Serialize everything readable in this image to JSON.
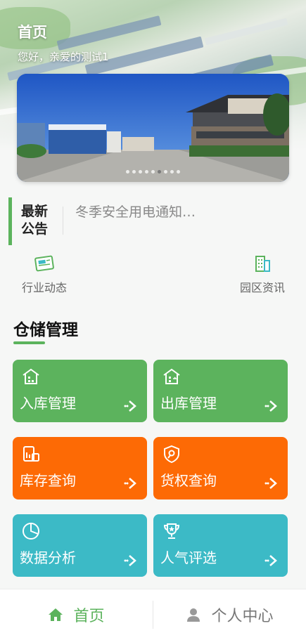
{
  "header": {
    "title": "首页",
    "greeting": "您好，亲爱的测试1"
  },
  "banner": {
    "slide_count": 9,
    "active_index": 5
  },
  "notice": {
    "label": "最新公告",
    "text": "冬季安全用电通知…"
  },
  "quick_links": [
    {
      "label": "行业动态",
      "icon": "news-icon"
    },
    {
      "label": "园区资讯",
      "icon": "building-icon"
    }
  ],
  "section": {
    "title": "仓储管理"
  },
  "cards": [
    {
      "label": "入库管理",
      "icon": "warehouse-in-icon",
      "color": "#5cb35d"
    },
    {
      "label": "出库管理",
      "icon": "warehouse-out-icon",
      "color": "#5cb35d"
    },
    {
      "label": "库存查询",
      "icon": "inventory-icon",
      "color": "#fd6a05"
    },
    {
      "label": "货权查询",
      "icon": "cargo-rights-icon",
      "color": "#fd6a05"
    },
    {
      "label": "数据分析",
      "icon": "pie-chart-icon",
      "color": "#3cbac6"
    },
    {
      "label": "人气评选",
      "icon": "trophy-icon",
      "color": "#3cbac6"
    }
  ],
  "tabbar": {
    "items": [
      {
        "label": "首页",
        "icon": "home-icon",
        "active": true
      },
      {
        "label": "个人中心",
        "icon": "user-icon",
        "active": false
      }
    ]
  },
  "colors": {
    "accent": "#5cb35d",
    "orange": "#fd6a05",
    "teal": "#3cbac6"
  }
}
